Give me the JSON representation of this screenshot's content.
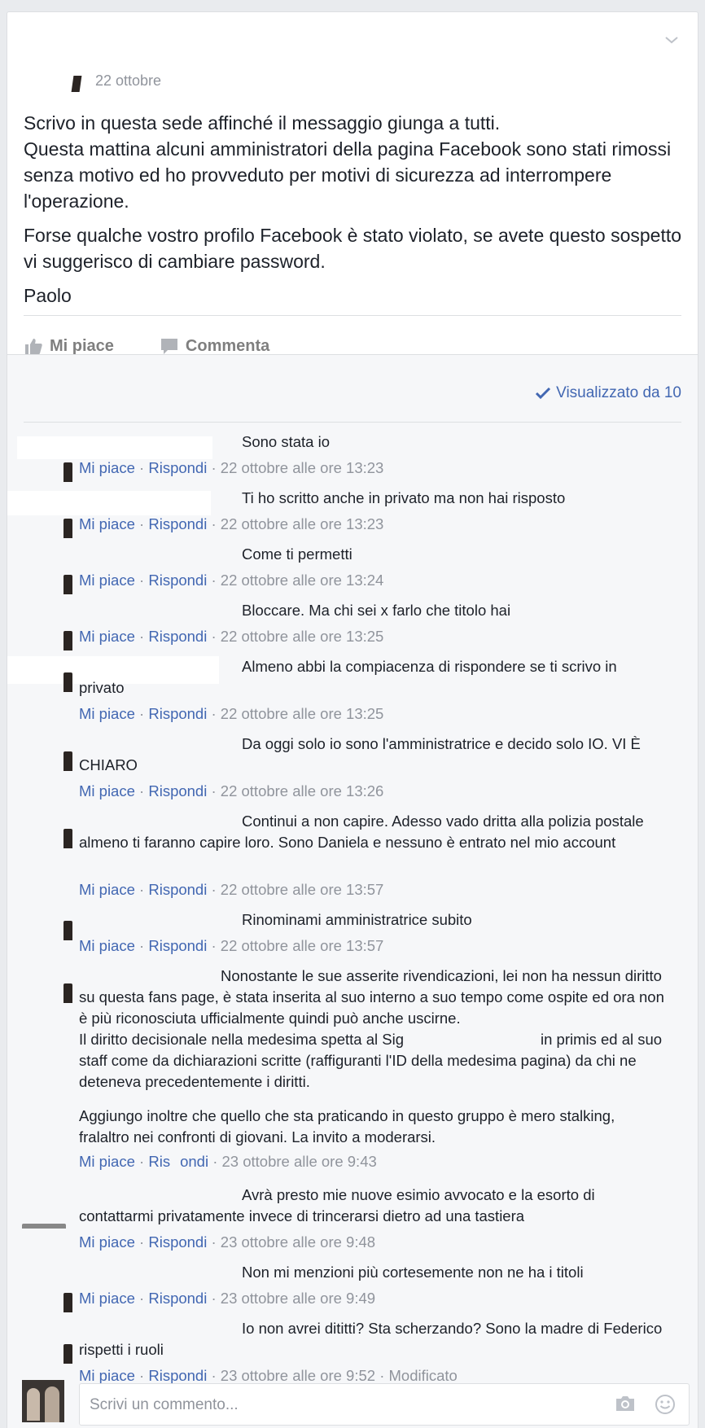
{
  "post": {
    "date": "22 ottobre",
    "paragraphs": [
      "Scrivo in questa sede affinché il messaggio giunga a tutti.\nQuesta mattina alcuni amministratori della pagina Facebook sono stati rimossi senza motivo ed ho provveduto per motivi di sicurezza ad interrompere l'operazione.",
      "Forse qualche vostro profilo Facebook è stato violato, se avete questo sospetto vi suggerisco di cambiare password.",
      "Paolo"
    ],
    "like_label": "Mi piace",
    "comment_label": "Commenta"
  },
  "seen_by": "Visualizzato da 10",
  "comments": [
    {
      "text": "Sono stata io",
      "like": "Mi piace",
      "reply": "Rispondi",
      "time": "· 22 ottobre alle ore 13:23"
    },
    {
      "text": "Ti ho scritto anche in privato ma non hai risposto",
      "like": "Mi piace",
      "reply": "Rispondi",
      "time": "· 22 ottobre alle ore 13:23"
    },
    {
      "text": "Come ti permetti",
      "like": "Mi piace",
      "reply": "Rispondi",
      "time": "· 22 ottobre alle ore 13:24"
    },
    {
      "text": "Bloccare. Ma chi sei x farlo che titolo hai",
      "like": "Mi piace",
      "reply": "Rispondi",
      "time": "· 22 ottobre alle ore 13:25"
    },
    {
      "text": "Almeno abbi la compiacenza di rispondere se ti scrivo in privato",
      "like": "Mi piace",
      "reply": "Rispondi",
      "time": "· 22 ottobre alle ore 13:25"
    },
    {
      "text": "Da oggi solo io sono l'amministratrice e decido solo IO. VI È CHIARO",
      "like": "Mi piace",
      "reply": "Rispondi",
      "time": "· 22 ottobre alle ore 13:26"
    },
    {
      "text": "Continui a non capire. Adesso vado dritta alla polizia postale almeno ti faranno capire loro. Sono Daniela e nessuno è entrato nel mio account",
      "like": "Mi piace",
      "reply": "Rispondi",
      "time": "· 22 ottobre alle ore 13:57"
    },
    {
      "text": "Rinominami amministratrice subito",
      "like": "Mi piace",
      "reply": "Rispondi",
      "time": "· 22 ottobre alle ore 13:57"
    },
    {
      "text": "Nonostante le sue asserite rivendicazioni, lei non ha nessun diritto su questa fans page, è stata inserita al suo interno a suo tempo come ospite ed ora non è più riconosciuta ufficialmente quindi può anche uscirne.",
      "text_2": "Il diritto decisionale nella medesima spetta al Sig",
      "text_3": "in primis ed al suo staff come da dichiarazioni scritte (raffiguranti l'ID della medesima pagina) da chi ne deteneva precedentemente i diritti.",
      "text_4": "Aggiungo inoltre che quello che sta praticando in questo gruppo è mero stalking, fralaltro nei confronti di giovani. La invito a moderarsi.",
      "like": "Mi piace",
      "reply": "Ris",
      "reply_2": "ondi",
      "time": "· 23 ottobre alle ore 9:43"
    },
    {
      "text": "Avrà presto mie nuove esimio avvocato e la esorto di contattarmi privatamente invece di trincerarsi dietro ad una tastiera",
      "like": "Mi piace",
      "reply": "Rispondi",
      "time": "· 23 ottobre alle ore 9:48"
    },
    {
      "text": "Non mi menzioni più cortesemente non ne ha i titoli",
      "like": "Mi piace",
      "reply": "Rispondi",
      "time": "· 23 ottobre alle ore 9:49"
    },
    {
      "text": "Io non avrei dititti? Sta scherzando? Sono la madre di Federico rispetti i ruoli",
      "like": "Mi piace",
      "reply": "Rispondi",
      "time": "· 23 ottobre alle ore 9:52 · Modificato"
    }
  ],
  "composer": {
    "placeholder": "Scrivi un commento..."
  }
}
